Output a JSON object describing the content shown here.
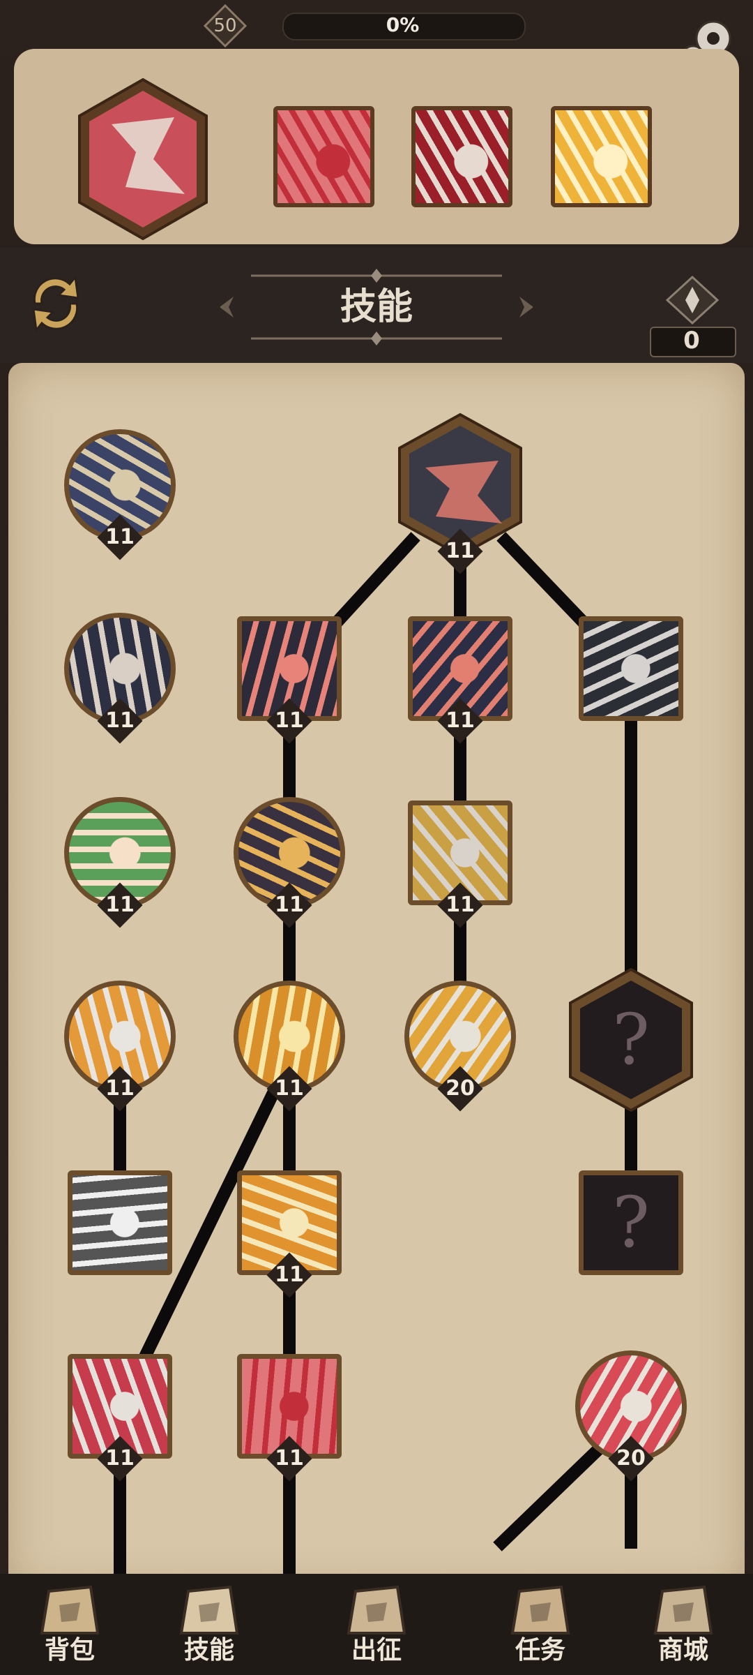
{
  "top_bar": {
    "level": "50",
    "xp_percent_text": "0%",
    "xp_progress": 0.0
  },
  "header": {
    "title": "技能",
    "currency_count": "0"
  },
  "equipped_skills": [
    {
      "name": "equipped-skill-1",
      "colors": [
        "#c94f5a",
        "#e8e2d6"
      ]
    },
    {
      "name": "equipped-skill-2",
      "colors": [
        "#e0757a",
        "#c22f3a"
      ]
    },
    {
      "name": "equipped-skill-3",
      "colors": [
        "#9b1f28",
        "#e6dad0"
      ]
    },
    {
      "name": "equipped-skill-4",
      "colors": [
        "#f0b33a",
        "#fff1c4"
      ]
    }
  ],
  "skill_nodes": [
    {
      "id": "n1",
      "shape": "circle",
      "level": "11",
      "c": [
        "#3b4466",
        "#d8c9a8"
      ]
    },
    {
      "id": "n2",
      "shape": "hex",
      "level": "11",
      "c": [
        "#3a3a46",
        "#e07a6e"
      ]
    },
    {
      "id": "n3",
      "shape": "circle",
      "level": "11",
      "c": [
        "#2d3042",
        "#d9cfc5"
      ]
    },
    {
      "id": "n4",
      "shape": "square",
      "level": "11",
      "c": [
        "#2d2a3a",
        "#e8837a"
      ]
    },
    {
      "id": "n5",
      "shape": "square",
      "level": "11",
      "c": [
        "#2b2e44",
        "#e27f70"
      ]
    },
    {
      "id": "n6",
      "shape": "square",
      "level": "",
      "c": [
        "#2b2e34",
        "#d6d2cf"
      ]
    },
    {
      "id": "n7",
      "shape": "circle",
      "level": "11",
      "c": [
        "#5aa05a",
        "#f6e0c8"
      ]
    },
    {
      "id": "n8",
      "shape": "circle",
      "level": "11",
      "c": [
        "#3a3140",
        "#e6b35a"
      ]
    },
    {
      "id": "n9",
      "shape": "square",
      "level": "11",
      "c": [
        "#c9a043",
        "#d9d2cb"
      ]
    },
    {
      "id": "n10",
      "shape": "circle",
      "level": "11",
      "c": [
        "#e59a3a",
        "#e8e4df"
      ]
    },
    {
      "id": "n11",
      "shape": "circle",
      "level": "11",
      "c": [
        "#d9902b",
        "#f8e6a6"
      ]
    },
    {
      "id": "n12",
      "shape": "circle",
      "level": "20",
      "c": [
        "#e2a53a",
        "#e6e2d8"
      ]
    },
    {
      "id": "n13",
      "shape": "hex",
      "level": "",
      "c": [
        "#221c1f",
        "#6d5d63"
      ]
    },
    {
      "id": "n14",
      "shape": "square",
      "level": "",
      "c": [
        "#555",
        "#efefef"
      ]
    },
    {
      "id": "n15",
      "shape": "square",
      "level": "11",
      "c": [
        "#e0932e",
        "#f5e7b8"
      ]
    },
    {
      "id": "n16",
      "shape": "square",
      "level": "",
      "c": [
        "#221c1f",
        "#6d5d63"
      ]
    },
    {
      "id": "n17",
      "shape": "square",
      "level": "11",
      "c": [
        "#c63c4d",
        "#e6e0da"
      ]
    },
    {
      "id": "n18",
      "shape": "square",
      "level": "11",
      "c": [
        "#e0757a",
        "#c22f3a"
      ]
    },
    {
      "id": "n19",
      "shape": "circle",
      "level": "20",
      "c": [
        "#d84b56",
        "#e8e2d9"
      ]
    }
  ],
  "unknown_mark": "?",
  "bottom_nav": [
    {
      "label": "背包",
      "icon": "backpack-icon"
    },
    {
      "label": "技能",
      "icon": "skill-book-icon"
    },
    {
      "label": "出征",
      "icon": "battle-scroll-icon"
    },
    {
      "label": "任务",
      "icon": "quest-scroll-icon"
    },
    {
      "label": "商城",
      "icon": "shop-crown-icon"
    }
  ]
}
